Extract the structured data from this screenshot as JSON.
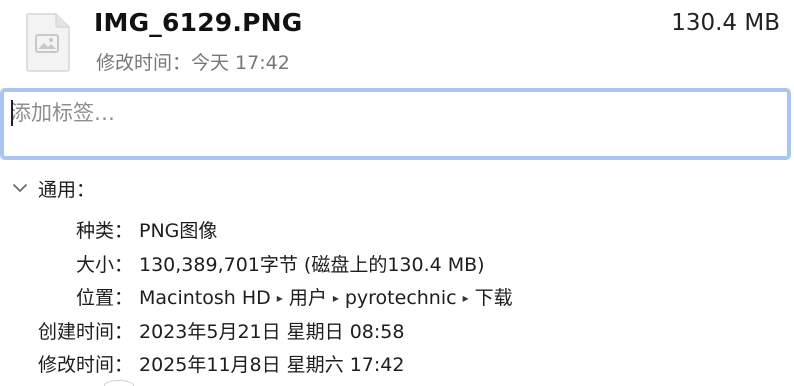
{
  "header": {
    "file_name": "IMG_6129.PNG",
    "file_size": "130.4 MB",
    "modified": "修改时间：今天 17:42",
    "file_icon": "image-document-icon"
  },
  "tags": {
    "placeholder": "添加标签…",
    "value": ""
  },
  "general": {
    "title": "通用：",
    "chevron_icon": "chevron-down-icon",
    "rows": [
      {
        "label": "种类：",
        "value": "PNG图像"
      },
      {
        "label": "大小：",
        "value": "130,389,701字节 (磁盘上的130.4 MB)"
      },
      {
        "label": "位置：",
        "path": [
          "Macintosh HD",
          "用户",
          "pyrotechnic",
          "下载"
        ],
        "separator_icon": "triangle-right-icon"
      },
      {
        "label": "创建时间：",
        "value": "2023年5月21日 星期日 08:58"
      },
      {
        "label": "修改时间：",
        "value": "2025年11月8日 星期六 17:42"
      }
    ]
  },
  "colors": {
    "focus_ring": "#a9c6f2",
    "secondary_text": "#777777",
    "placeholder_text": "#8e8e8e"
  }
}
